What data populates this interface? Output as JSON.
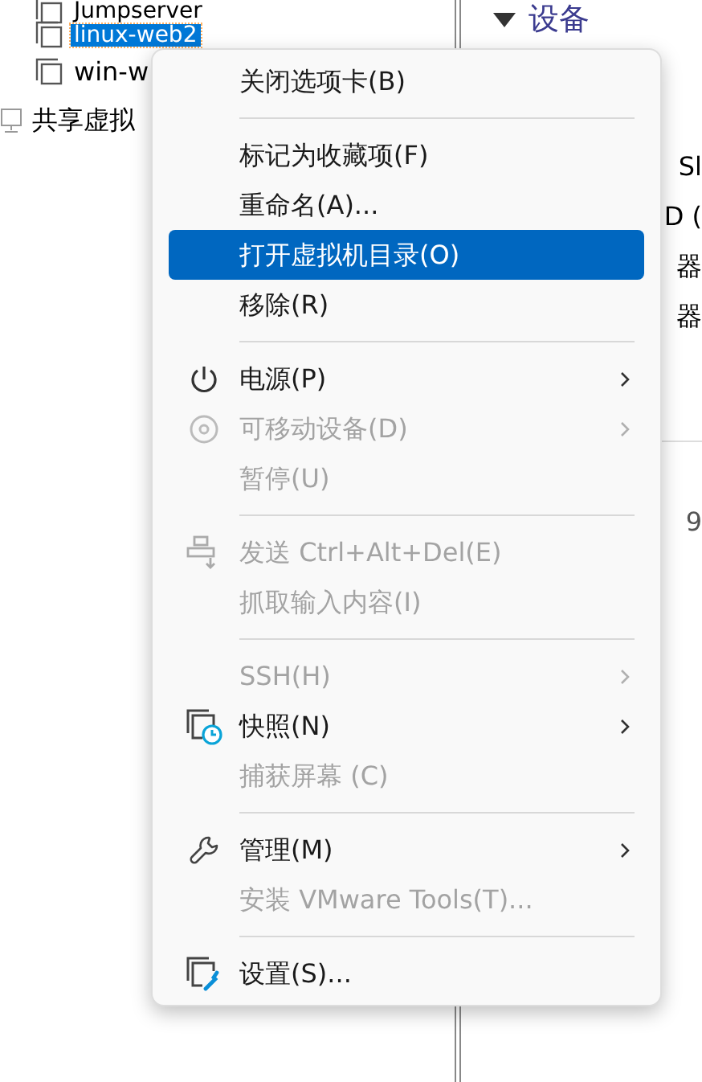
{
  "tree": {
    "items": [
      {
        "label": "Jumpserver",
        "selected": false,
        "kind": "vm"
      },
      {
        "label": "linux-web2",
        "selected": true,
        "kind": "vm"
      },
      {
        "label": "win-w",
        "selected": false,
        "kind": "vm"
      },
      {
        "label": "共享虚拟",
        "selected": false,
        "kind": "shared"
      }
    ]
  },
  "details": {
    "heading": "设备",
    "fragments": [
      "Sl",
      "D (",
      "器",
      "器"
    ],
    "bottom_fragment": "9"
  },
  "context_menu": {
    "items": [
      {
        "kind": "item",
        "label": "关闭选项卡(B)",
        "disabled": false,
        "selected": false,
        "submenu": false
      },
      {
        "kind": "separator"
      },
      {
        "kind": "item",
        "label": "标记为收藏项(F)",
        "disabled": false,
        "selected": false,
        "submenu": false
      },
      {
        "kind": "item",
        "label": "重命名(A)...",
        "disabled": false,
        "selected": false,
        "submenu": false
      },
      {
        "kind": "item",
        "label": "打开虚拟机目录(O)",
        "disabled": false,
        "selected": true,
        "submenu": false
      },
      {
        "kind": "item",
        "label": "移除(R)",
        "disabled": false,
        "selected": false,
        "submenu": false
      },
      {
        "kind": "separator"
      },
      {
        "kind": "item",
        "label": "电源(P)",
        "disabled": false,
        "selected": false,
        "submenu": true
      },
      {
        "kind": "item",
        "label": "可移动设备(D)",
        "disabled": true,
        "selected": false,
        "submenu": true
      },
      {
        "kind": "item",
        "label": "暂停(U)",
        "disabled": true,
        "selected": false,
        "submenu": false
      },
      {
        "kind": "separator"
      },
      {
        "kind": "item",
        "label": "发送 Ctrl+Alt+Del(E)",
        "disabled": true,
        "selected": false,
        "submenu": false
      },
      {
        "kind": "item",
        "label": "抓取输入内容(I)",
        "disabled": true,
        "selected": false,
        "submenu": false
      },
      {
        "kind": "separator"
      },
      {
        "kind": "item",
        "label": "SSH(H)",
        "disabled": true,
        "selected": false,
        "submenu": true
      },
      {
        "kind": "item",
        "label": "快照(N)",
        "disabled": false,
        "selected": false,
        "submenu": true
      },
      {
        "kind": "item",
        "label": "捕获屏幕 (C)",
        "disabled": true,
        "selected": false,
        "submenu": false
      },
      {
        "kind": "separator"
      },
      {
        "kind": "item",
        "label": "管理(M)",
        "disabled": false,
        "selected": false,
        "submenu": true
      },
      {
        "kind": "item",
        "label": "安装 VMware Tools(T)...",
        "disabled": true,
        "selected": false,
        "submenu": false
      },
      {
        "kind": "separator"
      },
      {
        "kind": "item",
        "label": "设置(S)...",
        "disabled": false,
        "selected": false,
        "submenu": false
      }
    ]
  }
}
